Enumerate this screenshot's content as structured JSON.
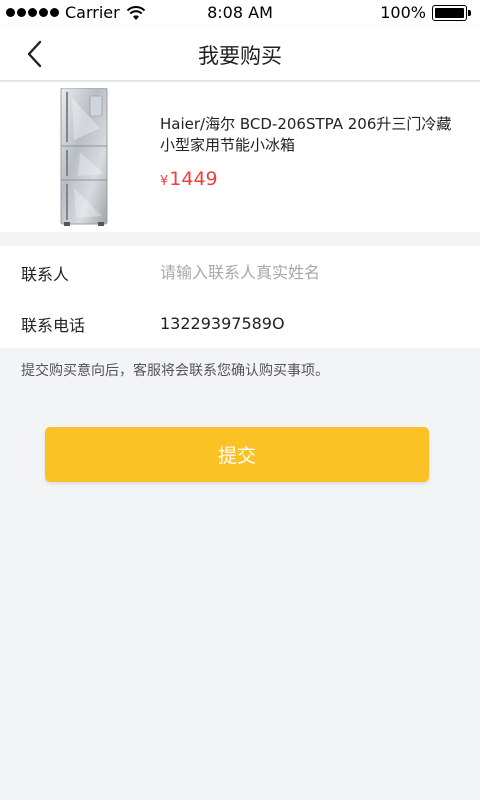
{
  "status_bar": {
    "carrier": "Carrier",
    "time": "8:08 AM",
    "battery": "100%",
    "battery_level": 1.0
  },
  "nav": {
    "back_icon": "chevron-left-icon",
    "title": "我要购买"
  },
  "product": {
    "name": "Haier/海尔 BCD-206STPA 206升三门冷藏小型家用节能小冰箱",
    "currency": "¥",
    "price": "1449",
    "image_icon": "refrigerator-image"
  },
  "form": {
    "contact_label": "联系人",
    "contact_placeholder": "请输入联系人真实姓名",
    "contact_value": "",
    "phone_label": "联系电话",
    "phone_value": "13229397589O"
  },
  "hint": "提交购买意向后，客服将会联系您确认购买事项。",
  "submit_label": "提交",
  "colors": {
    "accent": "#fbc225",
    "price": "#f23d3d"
  }
}
